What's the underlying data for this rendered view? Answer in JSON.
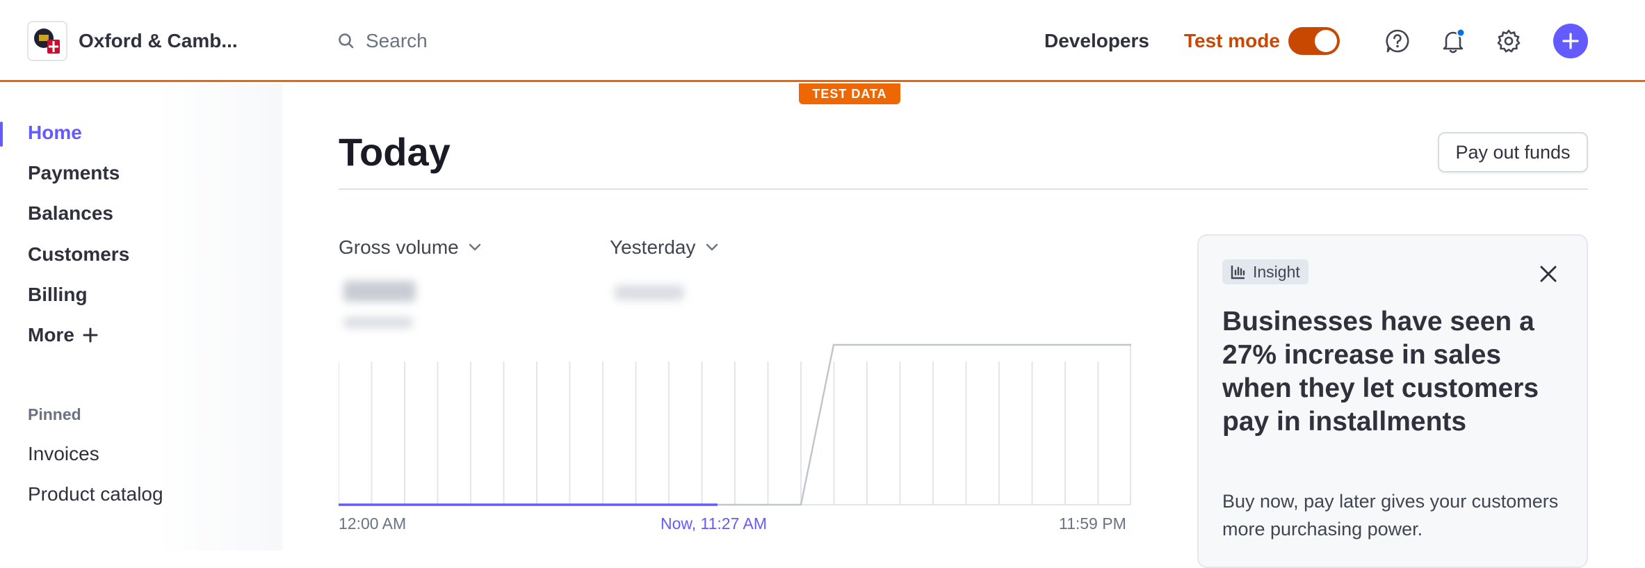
{
  "header": {
    "account_name": "Oxford & Camb...",
    "search_placeholder": "Search",
    "developers_label": "Developers",
    "test_mode_label": "Test mode",
    "test_mode_on": true,
    "test_data_banner": "TEST DATA",
    "accent_color": "#ed6704",
    "brand_color": "#635bff"
  },
  "sidebar": {
    "items": [
      {
        "label": "Home",
        "active": true
      },
      {
        "label": "Payments"
      },
      {
        "label": "Balances"
      },
      {
        "label": "Customers"
      },
      {
        "label": "Billing"
      },
      {
        "label": "More"
      }
    ],
    "pinned_label": "Pinned",
    "pinned": [
      {
        "label": "Invoices"
      },
      {
        "label": "Product catalog"
      }
    ]
  },
  "main": {
    "title": "Today",
    "payout_label": "Pay out funds",
    "metric_selector": "Gross volume",
    "compare_selector": "Yesterday"
  },
  "chart": {
    "x_start": "12:00 AM",
    "x_now": "Now, 11:27 AM",
    "x_end": "11:59 PM"
  },
  "insight": {
    "badge": "Insight",
    "heading": "Businesses have seen a 27% increase in sales when they let customers pay in installments",
    "body": "Buy now, pay later gives your customers more purchasing power."
  }
}
